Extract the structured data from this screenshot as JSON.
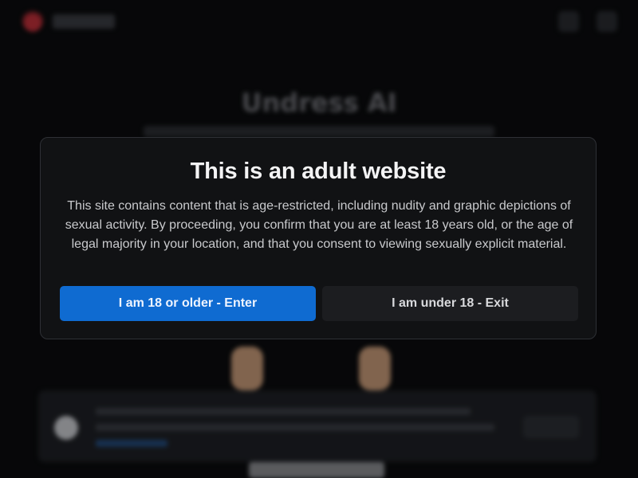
{
  "background": {
    "site_title": "Undress AI",
    "blurred": true
  },
  "modal": {
    "title": "This is an adult website",
    "body": "This site contains content that is age-restricted, including nudity and graphic depictions of sexual activity. By proceeding, you confirm that you are at least 18 years old, or the age of legal majority in your location, and that you consent to viewing sexually explicit material.",
    "enter_label": "I am 18 or older - Enter",
    "exit_label": "I am under 18 - Exit"
  },
  "colors": {
    "accent": "#0f6bd1",
    "modal_bg": "#111214",
    "page_bg": "#0b0c0e"
  }
}
